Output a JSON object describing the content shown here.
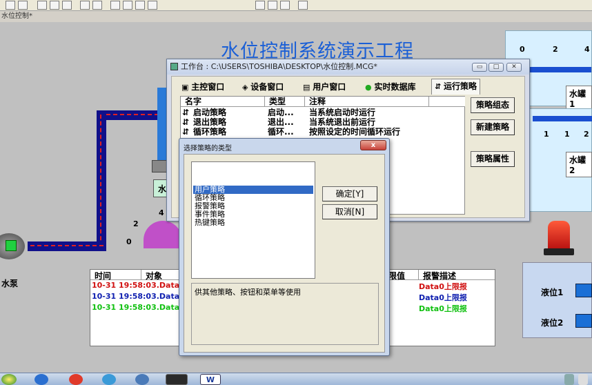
{
  "doc_tab": "水位控制*",
  "canvas": {
    "title": "水位控制系统演示工程",
    "pump_label": "水泵",
    "tank_labels": [
      "水罐1",
      "水罐2"
    ],
    "gauge_ticks_top": [
      "0",
      "2",
      "4"
    ],
    "gauge_ticks_mid": [
      "1",
      "1",
      "2"
    ],
    "dial_ticks": [
      "4",
      "2",
      "0"
    ],
    "level_labels": [
      "液位1",
      "液位2"
    ],
    "partial_label": "水"
  },
  "alarm": {
    "headers": [
      "时间",
      "对象",
      "限值",
      "报警描述"
    ],
    "rows": [
      {
        "time": "10-31 19:58:03.Data0",
        "desc": "Data0上限报",
        "color": "#d01010"
      },
      {
        "time": "10-31 19:58:03.Data0",
        "desc": "Data0上限报",
        "color": "#1020b0"
      },
      {
        "time": "10-31 19:58:03.Data0",
        "desc": "Data0上限报",
        "color": "#10c010"
      }
    ]
  },
  "workwin": {
    "title": "工作台 : C:\\USERS\\TOSHIBA\\DESKTOP\\水位控制.MCG*",
    "tabs": [
      "主控窗口",
      "设备窗口",
      "用户窗口",
      "实时数据库",
      "运行策略"
    ],
    "columns": [
      "名字",
      "类型",
      "注释"
    ],
    "rows": [
      {
        "name": "启动策略",
        "type": "启动...",
        "note": "当系统启动时运行"
      },
      {
        "name": "退出策略",
        "type": "退出...",
        "note": "当系统退出前运行"
      },
      {
        "name": "循环策略",
        "type": "循环...",
        "note": "按照设定的时间循环运行"
      }
    ],
    "buttons": [
      "策略组态",
      "新建策略",
      "策略属性"
    ]
  },
  "dialog": {
    "title": "选择策略的类型",
    "close": "x",
    "types": [
      "用户策略",
      "循环策略",
      "报警策略",
      "事件策略",
      "热键策略"
    ],
    "ok": "确定[Y]",
    "cancel": "取消[N]",
    "description": "供其他策略、按钮和菜单等使用"
  },
  "taskbar": {
    "word_label": "W"
  }
}
